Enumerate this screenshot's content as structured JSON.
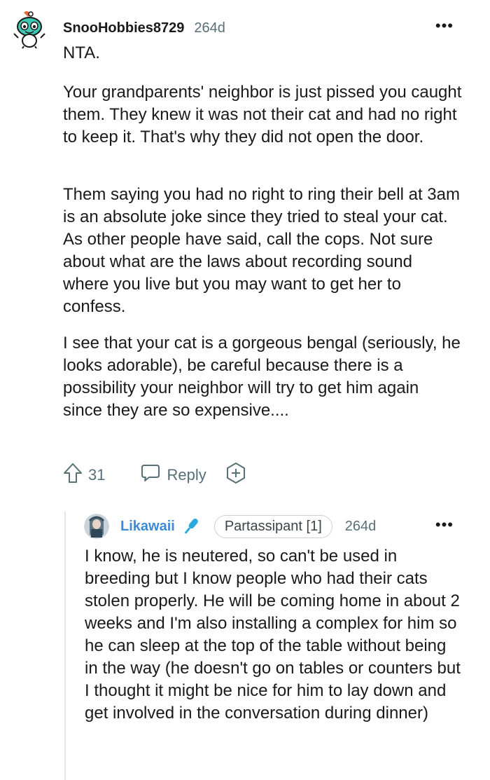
{
  "comment": {
    "username": "SnooHobbies8729",
    "age": "264d",
    "more": "•••",
    "paragraphs": [
      "NTA.",
      "Your grandparents' neighbor is just pissed you caught them. They knew it was not their cat and had no right to keep it. That's why they did not open the door.",
      "Them saying you had no right to ring their bell at 3am is an absolute joke since they tried to steal your cat. As other people have said, call the cops. Not sure about what are the laws about recording sound where you live but you may want to get her to confess.",
      "I see that your cat is a gorgeous bengal (seriously, he looks adorable), be careful because there is a possibility your neighbor will try to get him again since they are so expensive...."
    ],
    "upvotes": "31",
    "reply_label": "Reply"
  },
  "reply": {
    "username": "Likawaii",
    "flair": "Partassipant [1]",
    "age": "264d",
    "more": "•••",
    "text": "I know, he is neutered, so can't be used in breeding but I know people who had their cats stolen properly. He will be coming home in about 2 weeks and I'm also installing a complex for him so he can sleep at the top of the table without being in the way (he doesn't go on tables or counters but I thought it might be nice for him to lay down and get involved in the conversation during dinner)"
  },
  "colors": {
    "text": "#1a1a1b",
    "meta": "#576f76",
    "reply_username": "#3d8bd6",
    "thread_line": "#e2e7e9"
  },
  "icons": [
    "snoo-avatar-icon",
    "upvote-arrow-icon",
    "reply-bubble-icon",
    "award-plus-icon",
    "user-avatar-icon",
    "microphone-icon"
  ]
}
